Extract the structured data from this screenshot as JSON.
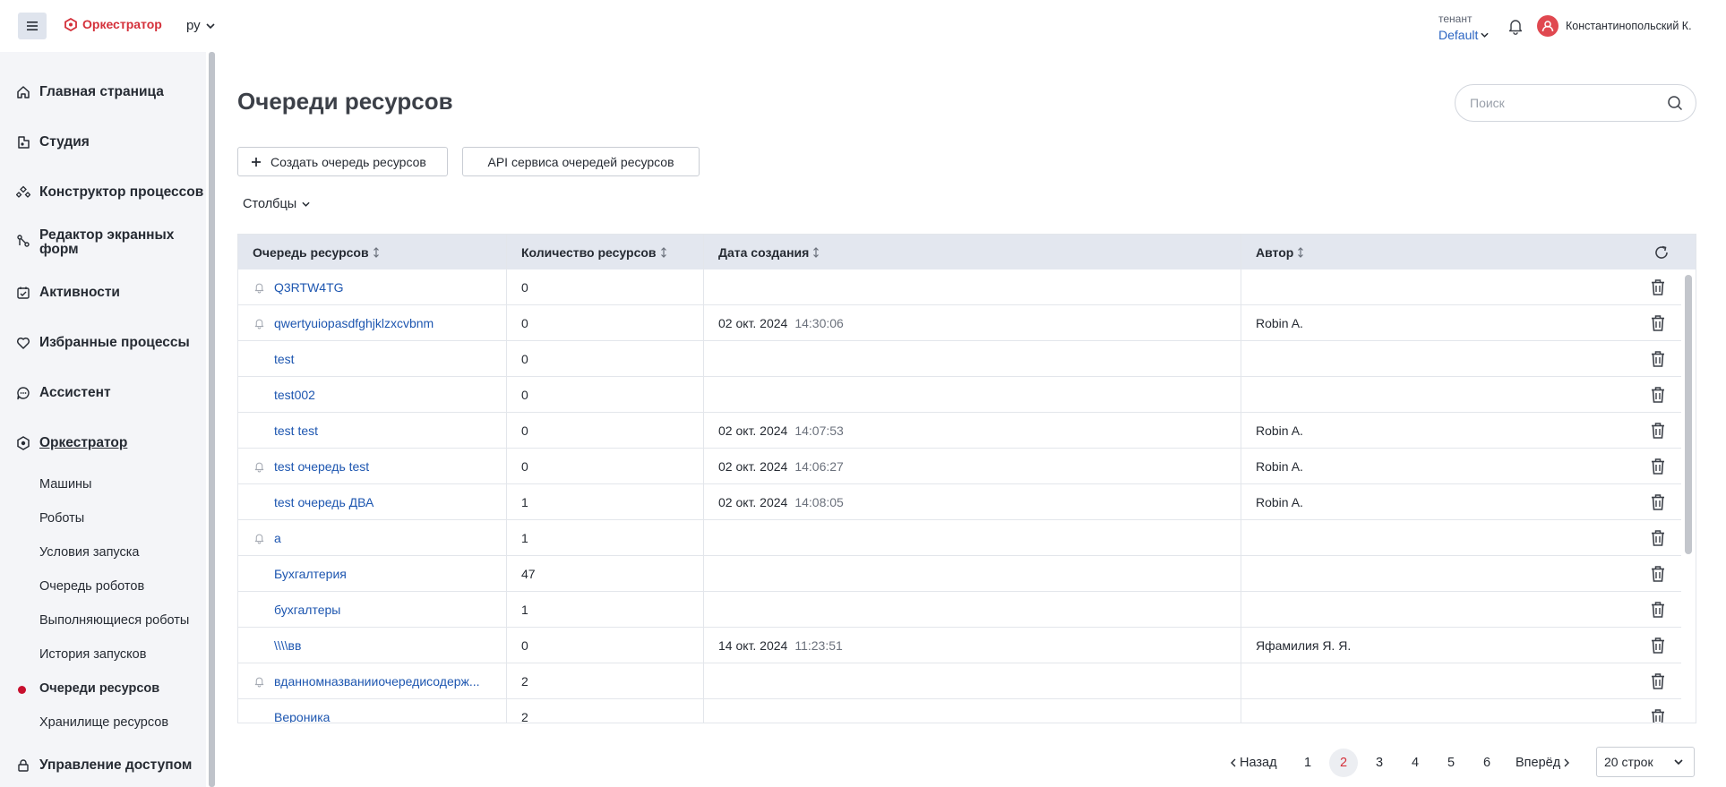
{
  "header": {
    "logo_text": "Оркестратор",
    "language": "ру",
    "tenant_label": "тенант",
    "tenant_value": "Default",
    "user_name": "Константинопольский К."
  },
  "sidebar": {
    "nav": [
      {
        "label": "Главная страница",
        "icon": "home-icon"
      },
      {
        "label": "Студия",
        "icon": "studio-icon"
      },
      {
        "label": "Конструктор процессов",
        "icon": "process-builder-icon"
      },
      {
        "label": "Редактор экранных форм",
        "icon": "form-editor-icon"
      },
      {
        "label": "Активности",
        "icon": "activities-icon"
      },
      {
        "label": "Избранные процессы",
        "icon": "heart-icon"
      },
      {
        "label": "Ассистент",
        "icon": "assistant-icon"
      },
      {
        "label": "Оркестратор",
        "icon": "orchestrator-icon"
      }
    ],
    "sub": [
      "Машины",
      "Роботы",
      "Условия запуска",
      "Очередь роботов",
      "Выполняющиеся роботы",
      "История запусков",
      "Очереди ресурсов",
      "Хранилище ресурсов"
    ],
    "bottom": {
      "label": "Управление доступом",
      "icon": "access-control-icon"
    }
  },
  "main": {
    "title": "Очереди ресурсов",
    "search_placeholder": "Поиск",
    "create_button": "Создать очередь ресурсов",
    "api_button": "API сервиса очередей ресурсов",
    "columns_toggle": "Столбцы"
  },
  "table": {
    "headers": {
      "name": "Очередь ресурсов",
      "count": "Количество ресурсов",
      "created": "Дата создания",
      "author": "Автор"
    },
    "rows": [
      {
        "name": "Q3RTW4TG",
        "bell": true,
        "count": "0",
        "date": "",
        "time": "",
        "author": ""
      },
      {
        "name": "qwertyuiopasdfghjklzxcvbnm",
        "bell": true,
        "count": "0",
        "date": "02 окт. 2024",
        "time": "14:30:06",
        "author": "Robin A."
      },
      {
        "name": "test",
        "bell": false,
        "count": "0",
        "date": "",
        "time": "",
        "author": ""
      },
      {
        "name": "test002",
        "bell": false,
        "count": "0",
        "date": "",
        "time": "",
        "author": ""
      },
      {
        "name": "test test",
        "bell": false,
        "count": "0",
        "date": "02 окт. 2024",
        "time": "14:07:53",
        "author": "Robin A."
      },
      {
        "name": "test очередь test",
        "bell": true,
        "count": "0",
        "date": "02 окт. 2024",
        "time": "14:06:27",
        "author": "Robin A."
      },
      {
        "name": "test очередь ДВА",
        "bell": false,
        "count": "1",
        "date": "02 окт. 2024",
        "time": "14:08:05",
        "author": "Robin A."
      },
      {
        "name": "а",
        "bell": true,
        "count": "1",
        "date": "",
        "time": "",
        "author": ""
      },
      {
        "name": "Бухгалтерия",
        "bell": false,
        "count": "47",
        "date": "",
        "time": "",
        "author": ""
      },
      {
        "name": "бухгалтеры",
        "bell": false,
        "count": "1",
        "date": "",
        "time": "",
        "author": ""
      },
      {
        "name": "\\\\\\\\вв",
        "bell": false,
        "count": "0",
        "date": "14 окт. 2024",
        "time": "11:23:51",
        "author": "Яфамилия Я. Я."
      },
      {
        "name": "вданномназванииочередисодерж...",
        "bell": true,
        "count": "2",
        "date": "",
        "time": "",
        "author": ""
      },
      {
        "name": "Вероника",
        "bell": false,
        "count": "2",
        "date": "",
        "time": "",
        "author": ""
      }
    ]
  },
  "pagination": {
    "prev": "Назад",
    "next": "Вперёд",
    "pages": [
      "1",
      "2",
      "3",
      "4",
      "5",
      "6"
    ],
    "current": "2",
    "page_size": "20 строк"
  },
  "colors": {
    "accent": "#d4303a",
    "link": "#1d56b0",
    "header_bg": "#e3e7ef"
  }
}
